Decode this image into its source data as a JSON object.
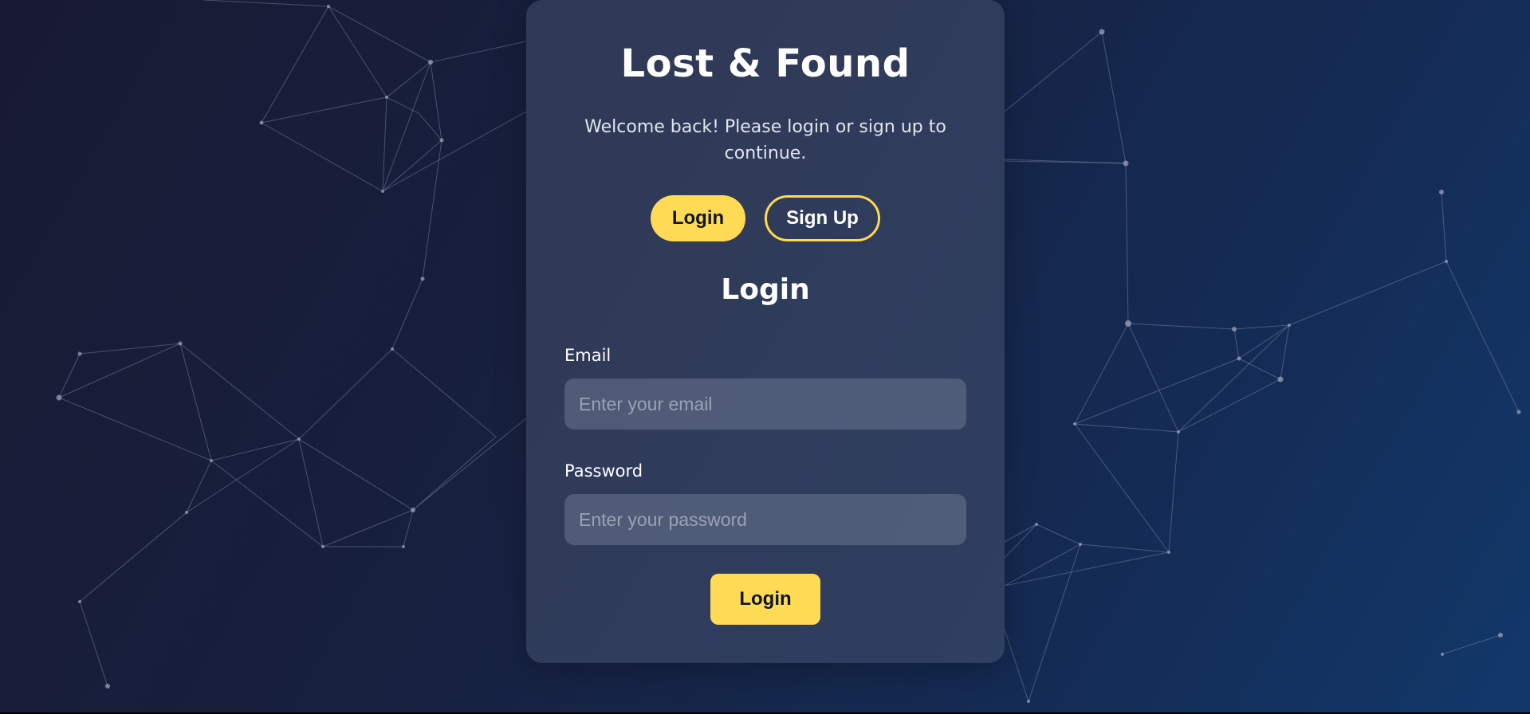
{
  "app": {
    "title": "Lost & Found",
    "subtitle": "Welcome back! Please login or sign up to continue."
  },
  "toggle": {
    "login_label": "Login",
    "signup_label": "Sign Up",
    "active": "Login"
  },
  "form": {
    "heading": "Login",
    "email": {
      "label": "Email",
      "placeholder": "Enter your email",
      "value": ""
    },
    "password": {
      "label": "Password",
      "placeholder": "Enter your password",
      "value": ""
    },
    "submit_label": "Login"
  },
  "colors": {
    "accent": "#ffdb55",
    "background_start": "#181a33",
    "background_end": "#12386a",
    "card": "#46506e"
  }
}
